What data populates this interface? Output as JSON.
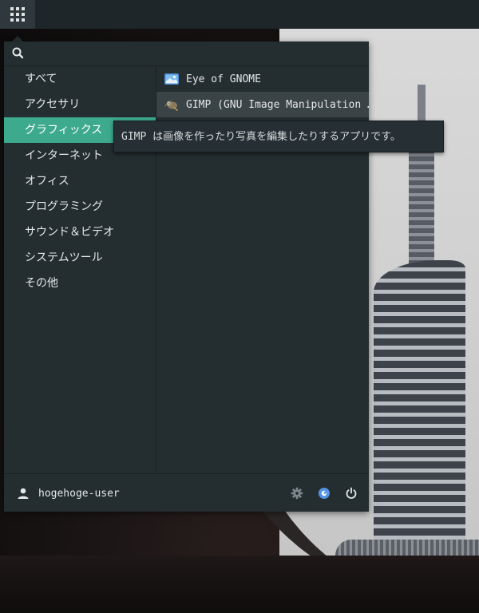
{
  "menu": {
    "search": {
      "placeholder": "",
      "value": ""
    },
    "categories": [
      {
        "label": "すべて",
        "active": false
      },
      {
        "label": "アクセサリ",
        "active": false
      },
      {
        "label": "グラフィックス",
        "active": true
      },
      {
        "label": "インターネット",
        "active": false
      },
      {
        "label": "オフィス",
        "active": false
      },
      {
        "label": "プログラミング",
        "active": false
      },
      {
        "label": "サウンド＆ビデオ",
        "active": false
      },
      {
        "label": "システムツール",
        "active": false
      },
      {
        "label": "その他",
        "active": false
      }
    ],
    "apps": [
      {
        "label": "Eye of GNOME",
        "icon": "image-viewer-icon"
      },
      {
        "label": "GIMP (GNU Image Manipulation …",
        "icon": "gimp-icon"
      }
    ],
    "tooltip": "GIMP は画像を作ったり写真を編集したりするアプリです。",
    "footer": {
      "user": "hogehoge-user"
    }
  },
  "colors": {
    "accent": "#3eaa8d",
    "panel": "#1f2629",
    "menu_bg": "#242d30"
  }
}
